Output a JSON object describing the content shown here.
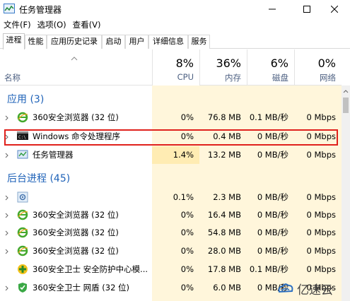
{
  "window": {
    "title": "任务管理器",
    "colors": {
      "title_bg": "#ffffff",
      "accent_blue": "#1e62b8"
    }
  },
  "menu": {
    "items": [
      "文件(F)",
      "选项(O)",
      "查看(V)"
    ]
  },
  "tabs": [
    "进程",
    "性能",
    "应用历史记录",
    "启动",
    "用户",
    "详细信息",
    "服务"
  ],
  "columns": {
    "name_label": "名称",
    "cpu": {
      "pct": "8%",
      "label": "CPU"
    },
    "memory": {
      "pct": "36%",
      "label": "内存"
    },
    "disk": {
      "pct": "6%",
      "label": "磁盘"
    },
    "network": {
      "pct": "0%",
      "label": "网络"
    }
  },
  "groups": {
    "apps": "应用 (3)",
    "background": "后台进程 (45)"
  },
  "rows": [
    {
      "name": "360安全浏览器 (32 位)",
      "icon": "ie-browser-icon",
      "cpu": "0%",
      "mem": "76.8 MB",
      "disk": "0.1 MB/秒",
      "net": "0 Mbps"
    },
    {
      "name": "Windows 命令处理程序",
      "icon": "cmd-icon",
      "cpu": "0%",
      "mem": "0.4 MB",
      "disk": "0 MB/秒",
      "net": "0 Mbps"
    },
    {
      "name": "任务管理器",
      "icon": "task-manager-icon",
      "cpu": "1.4%",
      "mem": "13.2 MB",
      "disk": "0 MB/秒",
      "net": "0 Mbps"
    },
    {
      "name": "",
      "icon": "gear-icon",
      "cpu": "0.1%",
      "mem": "2.3 MB",
      "disk": "0 MB/秒",
      "net": "0 Mbps"
    },
    {
      "name": "360安全浏览器 (32 位)",
      "icon": "ie-browser-icon",
      "cpu": "0%",
      "mem": "16.4 MB",
      "disk": "0 MB/秒",
      "net": "0 Mbps"
    },
    {
      "name": "360安全浏览器 (32 位)",
      "icon": "ie-browser-icon",
      "cpu": "0%",
      "mem": "54.8 MB",
      "disk": "0 MB/秒",
      "net": "0 Mbps"
    },
    {
      "name": "360安全浏览器 (32 位)",
      "icon": "ie-browser-icon",
      "cpu": "0%",
      "mem": "28.0 MB",
      "disk": "0 MB/秒",
      "net": "0 Mbps"
    },
    {
      "name": "360安全卫士 安全防护中心模...",
      "icon": "360-safe-plus-icon",
      "cpu": "0%",
      "mem": "17.8 MB",
      "disk": "0.1 MB/秒",
      "net": "0 Mbps"
    },
    {
      "name": "360安全卫士 网盾 (32 位)",
      "icon": "360-shield-icon",
      "cpu": "0%",
      "mem": "6.0 MB",
      "disk": "0 MB/秒",
      "net": "0 Mbps"
    }
  ],
  "watermark": {
    "text": "亿速云"
  }
}
